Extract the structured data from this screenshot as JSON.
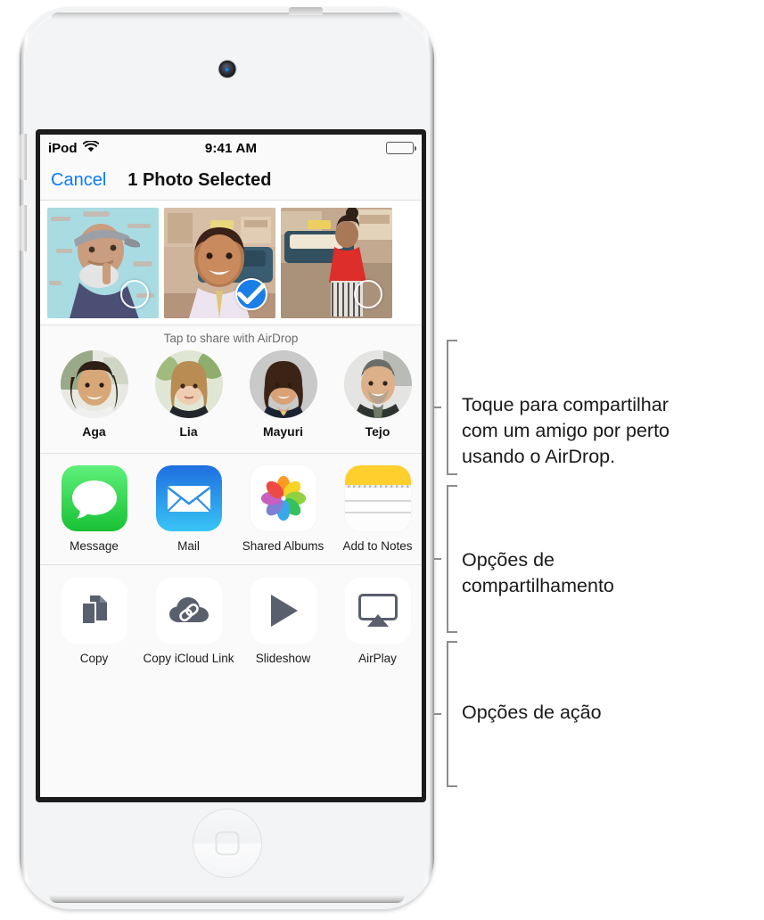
{
  "device": {
    "name": "iPod touch",
    "buttons": {
      "power": "power-button",
      "volume_up": "volume-up-button",
      "volume_down": "volume-down-button"
    }
  },
  "statusbar": {
    "carrier": "iPod",
    "wifi_icon": "wifi-icon",
    "time": "9:41 AM",
    "battery_icon": "battery-full-icon"
  },
  "navbar": {
    "cancel_label": "Cancel",
    "title": "1 Photo Selected"
  },
  "photos": [
    {
      "alt": "Older man with flat cap in front of turquoise wall",
      "selected": false
    },
    {
      "alt": "Smiling girl in embroidered tunic in front of blue car",
      "selected": true
    },
    {
      "alt": "Woman in red top beside taxi",
      "selected": false
    }
  ],
  "airdrop": {
    "label": "Tap to share with AirDrop",
    "contacts": [
      {
        "name": "Aga"
      },
      {
        "name": "Lia"
      },
      {
        "name": "Mayuri"
      },
      {
        "name": "Tejo"
      }
    ]
  },
  "share_options": [
    {
      "label": "Message",
      "icon": "messages-icon"
    },
    {
      "label": "Mail",
      "icon": "mail-icon"
    },
    {
      "label": "Shared\nAlbums",
      "icon": "photos-icon"
    },
    {
      "label": "Add to Notes",
      "icon": "notes-icon"
    }
  ],
  "action_options": [
    {
      "label": "Copy",
      "icon": "copy-icon"
    },
    {
      "label": "Copy iCloud\nLink",
      "icon": "icloud-link-icon"
    },
    {
      "label": "Slideshow",
      "icon": "play-icon"
    },
    {
      "label": "AirPlay",
      "icon": "airplay-icon"
    }
  ],
  "callouts": [
    {
      "text": "Toque para compartilhar\ncom um amigo por perto\nusando o AirDrop."
    },
    {
      "text": "Opções de\ncompartilhamento"
    },
    {
      "text": "Opções de ação"
    }
  ],
  "colors": {
    "accent_blue": "#0a7bff",
    "selection_blue": "#1a7ee8",
    "messages_green": "#4cd964",
    "mail_blue": "#2f8fff",
    "notes_yellow": "#ffcf2e",
    "icon_gray": "#5a5f6e",
    "bracket_gray": "#8c8c8c"
  }
}
